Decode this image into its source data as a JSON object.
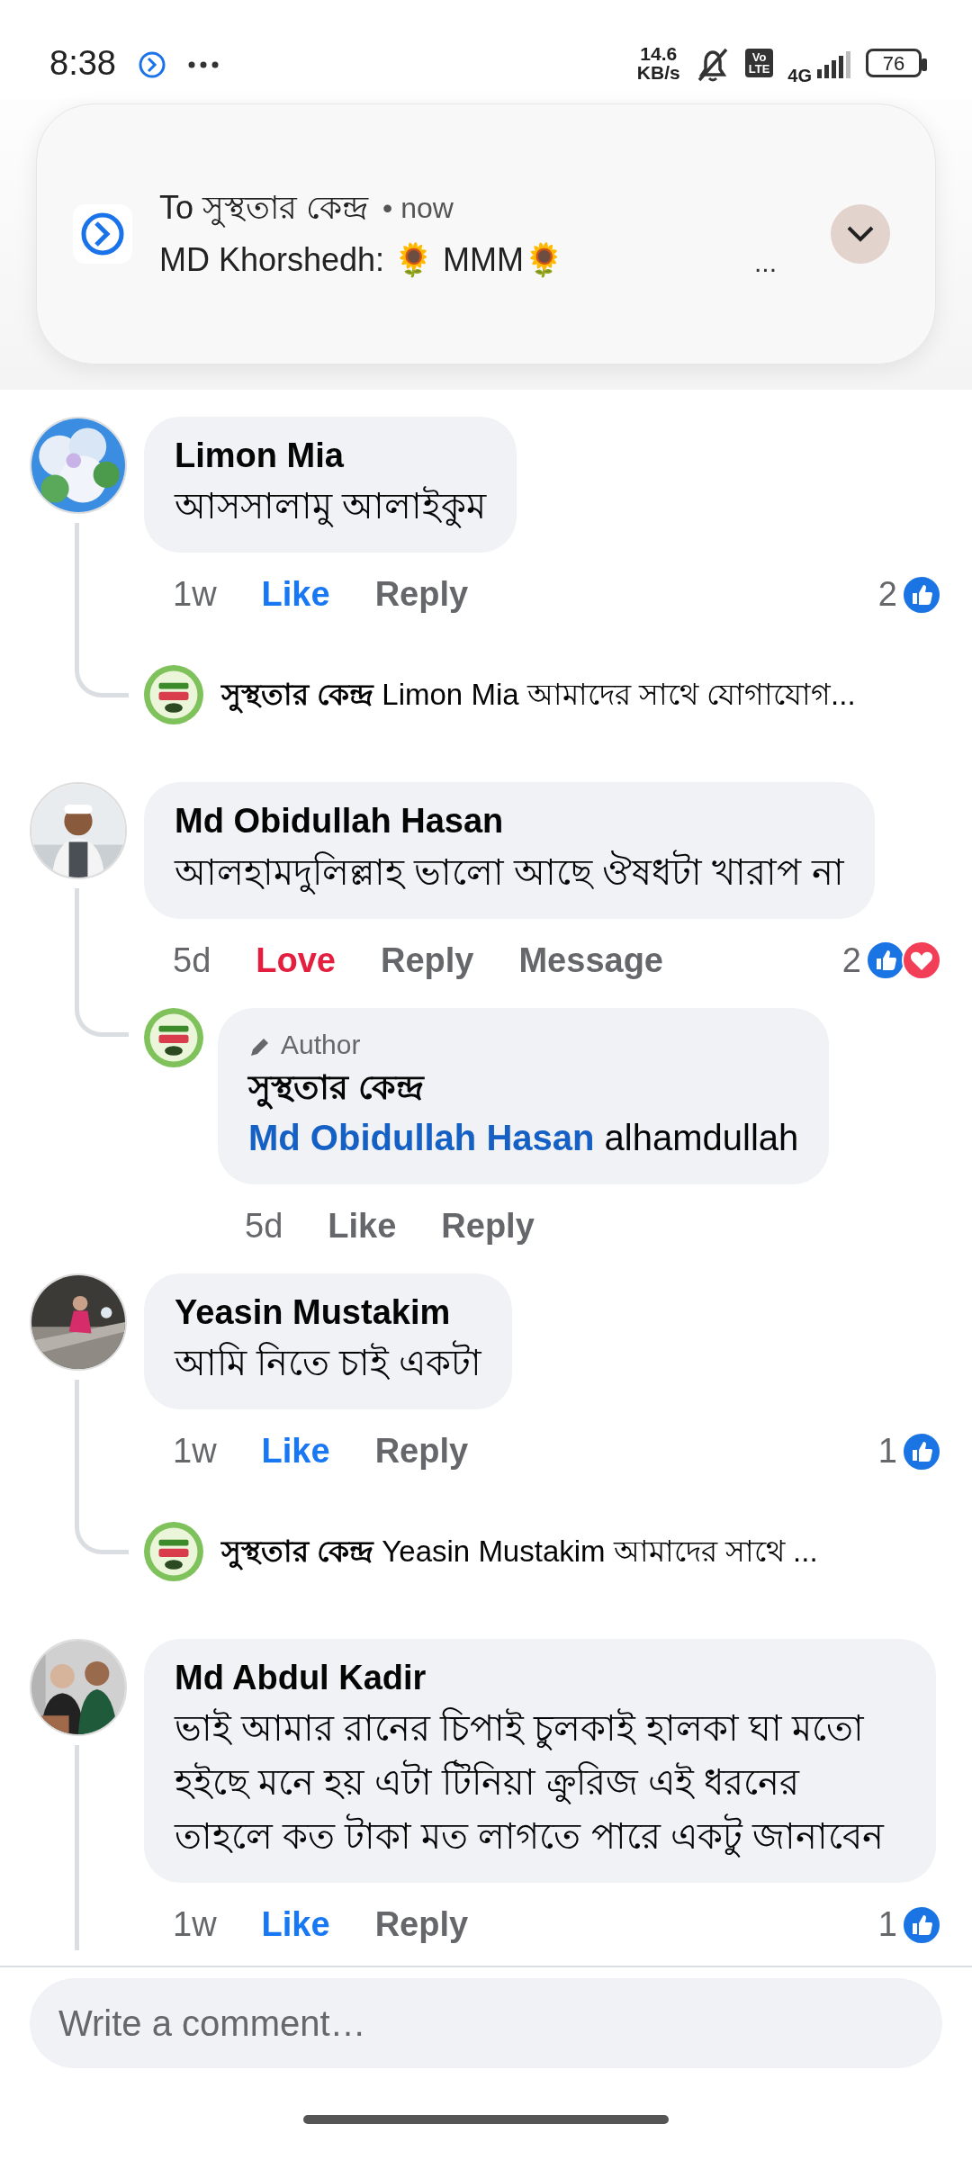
{
  "status_bar": {
    "time": "8:38",
    "speed_value": "14.6",
    "speed_unit": "KB/s",
    "volte_top": "Vo",
    "volte_bottom": "LTE",
    "network": "4G",
    "battery": "76"
  },
  "notification": {
    "title": "To সুস্থতার কেন্দ্র",
    "time": "• now",
    "body": "MD Khorshedh: 🌻 MMM🌻",
    "more": "...",
    "expanded": false
  },
  "comments": [
    {
      "name": "Limon Mia",
      "text": "আসসালামু আলাইকুম",
      "time": "1w",
      "actions": [
        {
          "label": "Like",
          "reacted": true,
          "color": "#1877f2"
        },
        {
          "label": "Reply"
        }
      ],
      "reactions": {
        "count": "2",
        "icons": [
          {
            "kind": "like"
          }
        ]
      },
      "reply": {
        "kind": "preview",
        "name": "সুস্থতার কেন্দ্র",
        "text": "Limon Mia আমাদের সাথে যোগাযোগ..."
      }
    },
    {
      "name": "Md Obidullah Hasan",
      "text": "আলহামদুলিল্লাহ ভালো আছে ঔষধটা খারাপ না",
      "time": "5d",
      "actions": [
        {
          "label": "Love",
          "reacted": true,
          "color": "#e41e3f"
        },
        {
          "label": "Reply"
        },
        {
          "label": "Message"
        }
      ],
      "reactions": {
        "count": "2",
        "icons": [
          {
            "kind": "like"
          },
          {
            "kind": "love"
          }
        ]
      },
      "reply": {
        "kind": "full",
        "badge": "Author",
        "name": "সুস্থতার কেন্দ্র",
        "mention": "Md Obidullah Hasan",
        "text": "alhamdullah",
        "time": "5d",
        "actions": [
          {
            "label": "Like",
            "reacted": false
          },
          {
            "label": "Reply"
          }
        ]
      }
    },
    {
      "name": "Yeasin Mustakim",
      "text": "আমি নিতে চাই একটা",
      "time": "1w",
      "actions": [
        {
          "label": "Like",
          "reacted": true,
          "color": "#1877f2"
        },
        {
          "label": "Reply"
        }
      ],
      "reactions": {
        "count": "1",
        "icons": [
          {
            "kind": "like"
          }
        ]
      },
      "reply": {
        "kind": "preview",
        "name": "সুস্থতার কেন্দ্র",
        "text": "Yeasin Mustakim আমাদের সাথে ..."
      }
    },
    {
      "name": "Md Abdul Kadir",
      "text": "ভাই আমার রানের চিপাই চুলকাই হালকা ঘা মতো হইছে মনে হয় এটা টিনিয়া ক্রুরিজ এই ধরনের\nতাহলে কত টাকা মত লাগতে পারে একটু জানাবেন",
      "time": "1w",
      "thread_continues": true,
      "actions": [
        {
          "label": "Like",
          "reacted": true,
          "color": "#1877f2"
        },
        {
          "label": "Reply"
        }
      ],
      "reactions": {
        "count": "1",
        "icons": [
          {
            "kind": "like"
          }
        ]
      }
    }
  ],
  "composer": {
    "placeholder": "Write a comment…"
  }
}
